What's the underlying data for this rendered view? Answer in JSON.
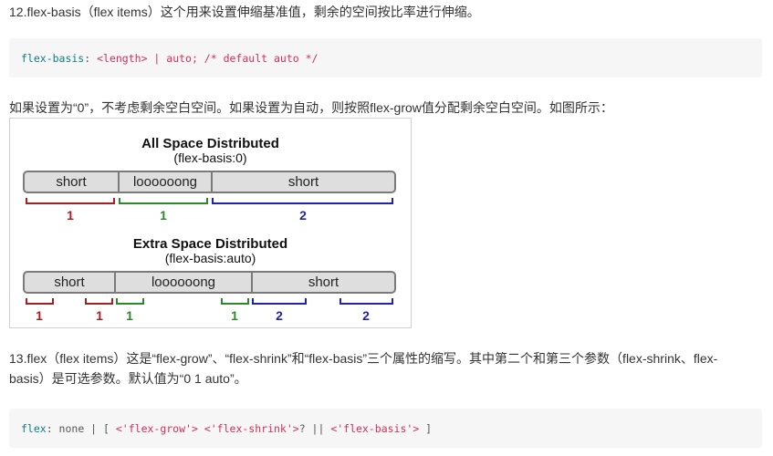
{
  "sections": {
    "item12": "12.flex-basis（flex items）这个用来设置伸缩基准值，剩余的空间按比率进行伸缩。",
    "code1": {
      "prop": "flex-basis",
      "colon": ": ",
      "value": "<length> | auto; /* default auto */"
    },
    "note": "如果设置为“0”，不考虑剩余空白空间。如果设置为自动，则按照flex-grow值分配剩余空白空间。如图所示：",
    "item13_line1": "13.flex（flex items）这是“flex-grow”、“flex-shrink”和“flex-basis”三个属性的缩写。其中第二个和第三个参数（flex-shrink、flex-",
    "item13_line2": "basis）是可选参数。默认值为“0 1 auto”。",
    "code2": {
      "prop": "flex",
      "p1": ": none | [ ",
      "t1": "<'flex-grow'>",
      "p2": " ",
      "t2": "<'flex-shrink'>",
      "p3": "? || ",
      "t3": "<'flex-basis'>",
      "p4": " ]"
    }
  },
  "figure": {
    "diagram1": {
      "title": "All Space Distributed",
      "subtitle": "(flex-basis:0)",
      "segments": [
        "short",
        "loooooong",
        "short"
      ],
      "numbers": [
        "1",
        "1",
        "2"
      ]
    },
    "diagram2": {
      "title": "Extra Space Distributed",
      "subtitle": "(flex-basis:auto)",
      "segments": [
        "short",
        "loooooong",
        "short"
      ],
      "numbers": [
        "1",
        "1",
        "1",
        "1",
        "2",
        "2"
      ]
    },
    "colors": {
      "red": "#a52020",
      "green": "#2c8a2c",
      "blue": "#2222b0"
    }
  }
}
